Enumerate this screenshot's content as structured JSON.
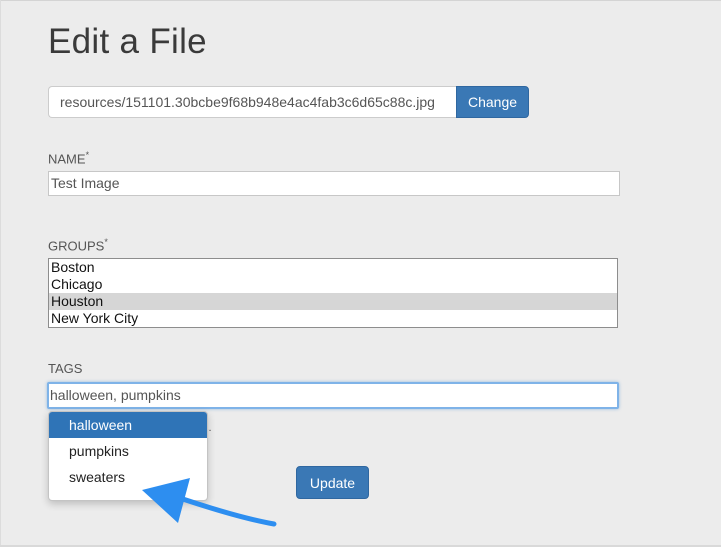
{
  "page": {
    "title": "Edit a File"
  },
  "file": {
    "path": "resources/151101.30bcbe9f68b948e4ac4fab3c6d65c88c.jpg",
    "change_label": "Change"
  },
  "name_field": {
    "label": "NAME",
    "required_mark": "*",
    "value": "Test Image"
  },
  "groups_field": {
    "label": "GROUPS",
    "required_mark": "*",
    "options": [
      "Boston",
      "Chicago",
      "Houston",
      "New York City"
    ],
    "selected": "Houston"
  },
  "tags_field": {
    "label": "TAGS",
    "value": "halloween, pumpkins",
    "help_text_visible": "s."
  },
  "autocomplete": {
    "items": [
      "halloween",
      "pumpkins",
      "sweaters"
    ],
    "active": "halloween"
  },
  "actions": {
    "update_label": "Update"
  },
  "colors": {
    "button": "#3a78b5",
    "dropdown_active": "#2f74b7",
    "focus_border": "#7fb3e8",
    "annotation_arrow": "#2d8ef0"
  }
}
